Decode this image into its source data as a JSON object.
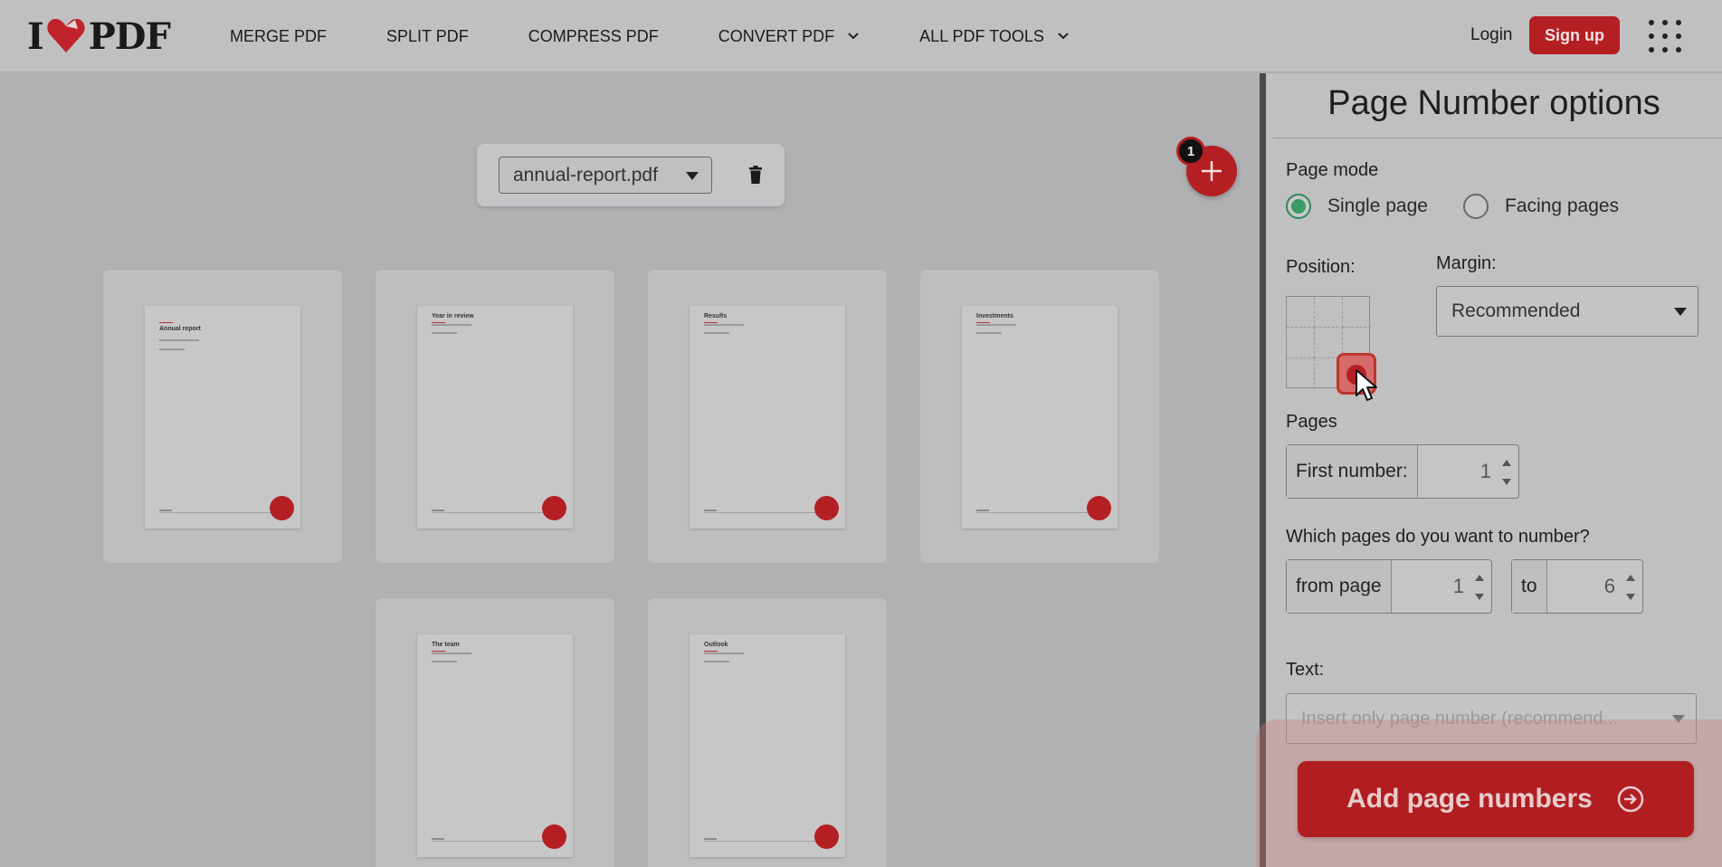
{
  "brand": {
    "logo_left": "I",
    "logo_right": "PDF",
    "accent": "#b41f23"
  },
  "nav": {
    "items": [
      {
        "label": "MERGE PDF",
        "dropdown": false
      },
      {
        "label": "SPLIT PDF",
        "dropdown": false
      },
      {
        "label": "COMPRESS PDF",
        "dropdown": false
      },
      {
        "label": "CONVERT PDF",
        "dropdown": true
      },
      {
        "label": "ALL PDF TOOLS",
        "dropdown": true
      }
    ],
    "login": "Login",
    "signup": "Sign up",
    "apps_icon": "grid-menu-icon"
  },
  "workspace": {
    "file_name": "annual-report.pdf",
    "file_count_badge": "1",
    "pages": [
      {
        "title": "Annual report"
      },
      {
        "title": "Year in review"
      },
      {
        "title": "Results"
      },
      {
        "title": "Investments"
      },
      {
        "title": "The team"
      },
      {
        "title": "Outlook"
      }
    ]
  },
  "panel": {
    "title": "Page Number options",
    "page_mode_label": "Page mode",
    "modes": [
      {
        "label": "Single page",
        "checked": true
      },
      {
        "label": "Facing pages",
        "checked": false
      }
    ],
    "position_label": "Position:",
    "position_selected": "bottom-right",
    "margin_label": "Margin:",
    "margin_value": "Recommended",
    "pages_label": "Pages",
    "first_number_label": "First number:",
    "first_number_value": "1",
    "which_pages_label": "Which pages do you want to number?",
    "from_label": "from page",
    "from_value": "1",
    "to_label": "to",
    "to_value": "6",
    "text_label": "Text:",
    "text_value": "Insert only page number (recommend...",
    "cta": "Add page numbers"
  }
}
